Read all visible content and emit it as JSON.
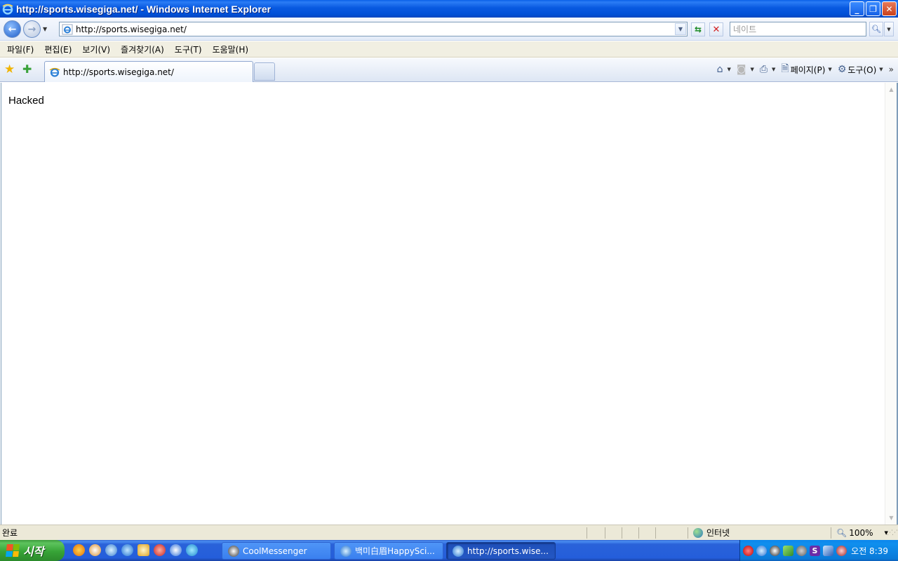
{
  "window": {
    "title": "http://sports.wisegiga.net/ - Windows Internet Explorer",
    "controls": [
      "minimize-icon",
      "restore-icon",
      "close-icon"
    ]
  },
  "address_bar": {
    "url": "http://sports.wisegiga.net/",
    "search_placeholder": "네이트"
  },
  "menu": {
    "items": [
      "파일(F)",
      "편집(E)",
      "보기(V)",
      "즐겨찾기(A)",
      "도구(T)",
      "도움말(H)"
    ]
  },
  "tabs": {
    "active_label": "http://sports.wisegiga.net/"
  },
  "command_bar": {
    "page_label": "페이지(P)",
    "tools_label": "도구(O)"
  },
  "content": {
    "text": "Hacked"
  },
  "status": {
    "text": "완료",
    "zone": "인터넷",
    "zoom": "100%"
  },
  "taskbar": {
    "start_label": "시작",
    "buttons": [
      {
        "label": "CoolMessenger",
        "state": "inactive"
      },
      {
        "label": "백미白眉HappySci...",
        "state": "inactive"
      },
      {
        "label": "http://sports.wise...",
        "state": "active"
      }
    ],
    "clock": "오전 8:39"
  },
  "colors": {
    "titlebar": "#0a5fe8",
    "taskbar": "#245edb",
    "start_button": "#37a437",
    "tray": "#0f8fee"
  }
}
